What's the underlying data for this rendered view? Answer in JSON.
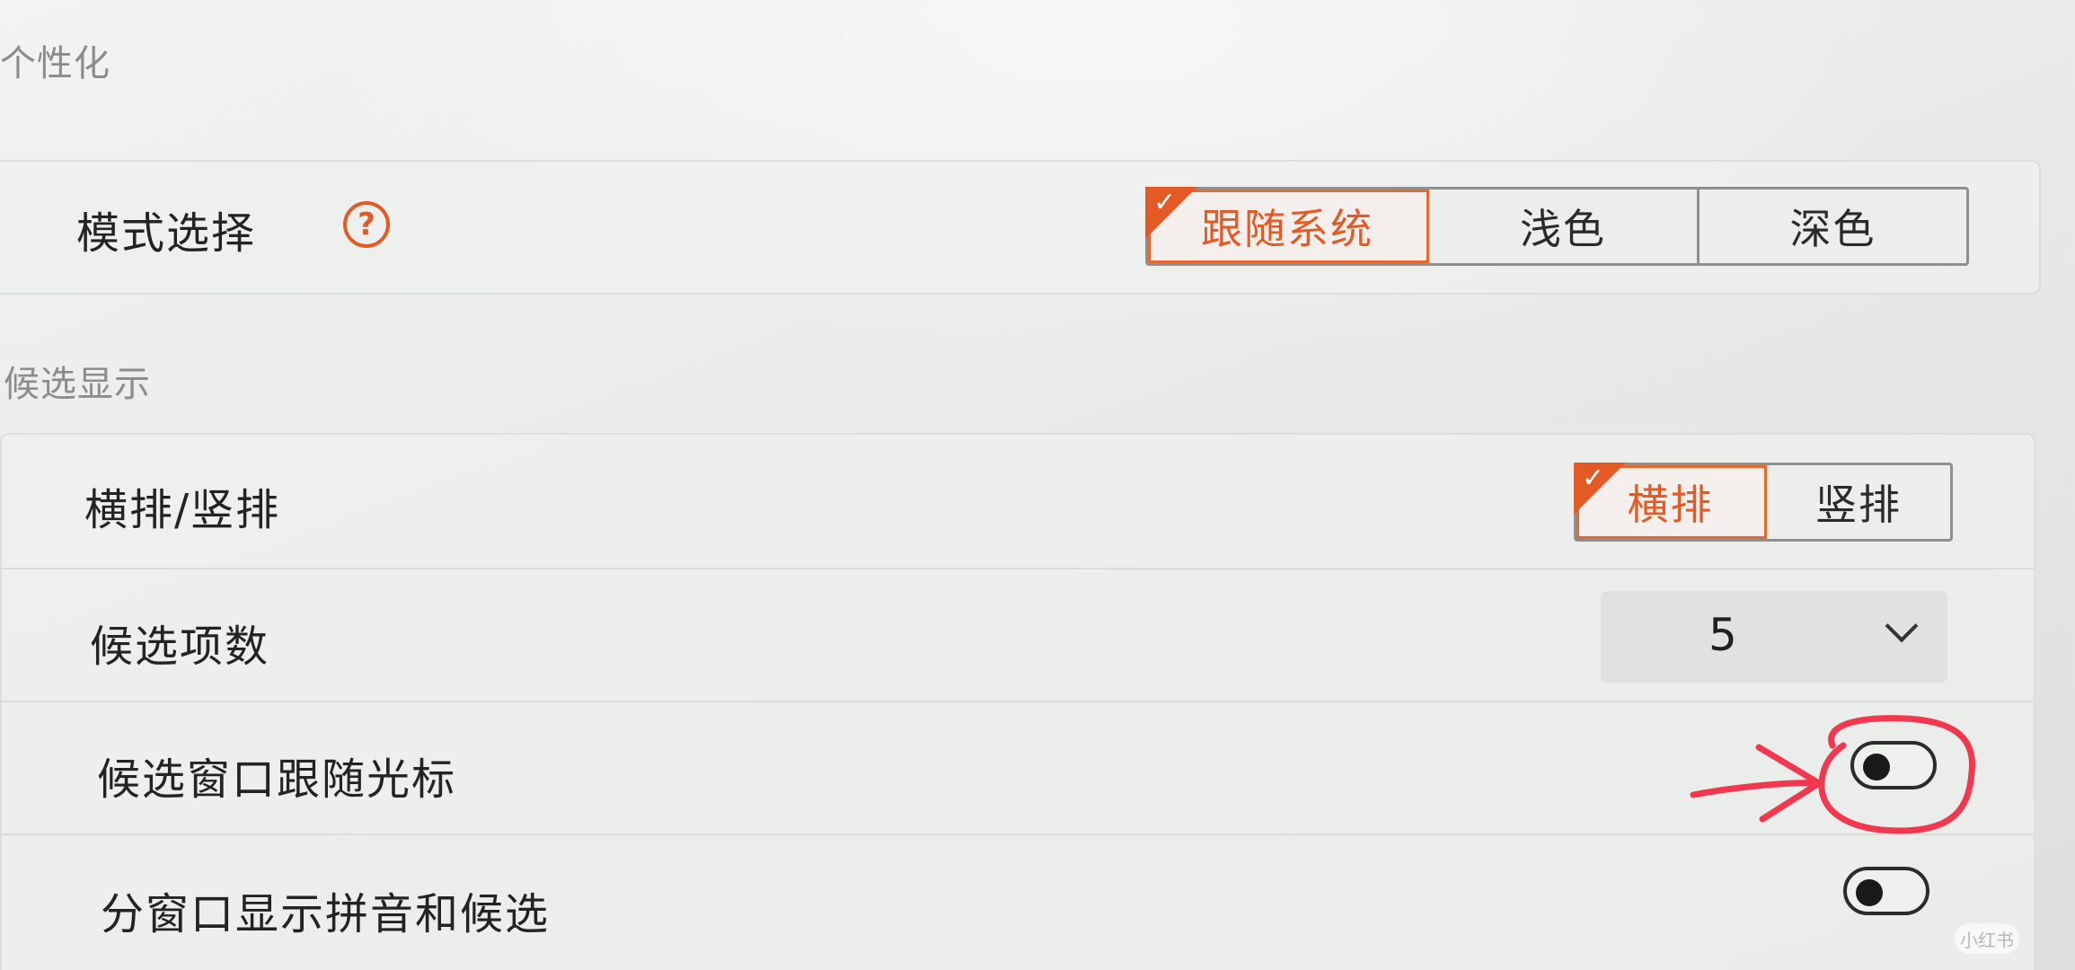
{
  "sections": {
    "personalization": "个性化",
    "candidate_display": "候选显示"
  },
  "mode": {
    "label": "模式选择",
    "help_glyph": "?",
    "options": [
      "跟随系统",
      "浅色",
      "深色"
    ],
    "selected": "跟随系统"
  },
  "orientation": {
    "label": "横排/竖排",
    "options": [
      "横排",
      "竖排"
    ],
    "selected": "横排"
  },
  "candidate_count": {
    "label": "候选项数",
    "value": "5"
  },
  "follow_cursor": {
    "label": "候选窗口跟随光标",
    "on": false
  },
  "split_window": {
    "label": "分窗口显示拼音和候选",
    "on": false
  },
  "check_glyph": "✓",
  "watermark_text": "小红书",
  "colors": {
    "accent": "#e45a25",
    "annotation": "#f2384f"
  },
  "icons": {
    "help": "question-circle-icon",
    "chevron": "chevron-down-icon",
    "check": "check-corner-icon"
  }
}
